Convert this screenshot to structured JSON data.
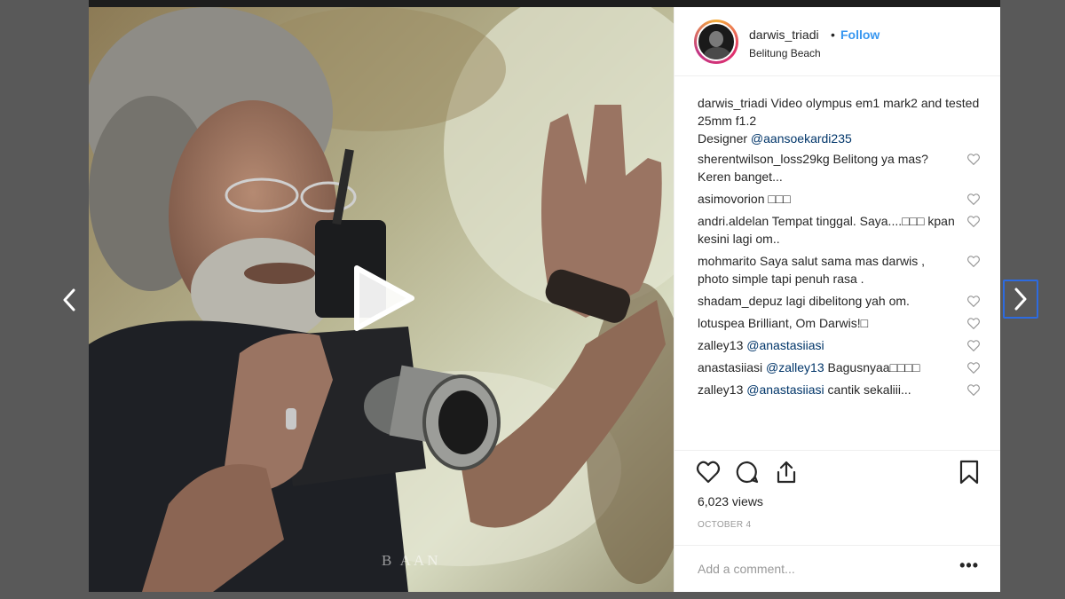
{
  "header": {
    "username": "darwis_triadi",
    "separator": "•",
    "follow_label": "Follow",
    "location": "Belitung Beach"
  },
  "caption": {
    "username": "darwis_triadi",
    "text_line1": " Video olympus em1 mark2 and tested 25mm f1.2",
    "text_prefix": "Designer ",
    "mention": "@aansoekardi235"
  },
  "comments": [
    {
      "user": "sherentwilson_loss29kg",
      "text": " Belitong ya mas? Keren banget..."
    },
    {
      "user": "asimovorion",
      "text": " □□□"
    },
    {
      "user": "andri.aldelan",
      "text": " Tempat tinggal. Saya....□□□ kpan kesini lagi om.."
    },
    {
      "user": "mohmarito",
      "text": " Saya salut sama mas darwis , photo simple tapi penuh rasa ."
    },
    {
      "user": "shadam_depuz",
      "text": " lagi dibelitong yah om."
    },
    {
      "user": "lotuspea",
      "text": " Brilliant, Om Darwis!□"
    },
    {
      "user": "zalley13",
      "text": "",
      "mention": "@anastasiiasi",
      "after": ""
    },
    {
      "user": "anastasiiasi",
      "text": "",
      "mention": "@zalley13",
      "after": " Bagusnyaa□□□□"
    },
    {
      "user": "zalley13",
      "text": "",
      "mention": "@anastasiiasi",
      "after": " cantik sekaliii..."
    }
  ],
  "stats": {
    "views": "6,023 views",
    "date": "OCTOBER 4"
  },
  "add_comment": {
    "placeholder": "Add a comment..."
  },
  "more_label": "•••",
  "media": {
    "watermark": "B              AAN"
  },
  "icons": {
    "prev": "chevron-left-icon",
    "next": "chevron-right-icon",
    "play": "play-icon",
    "like": "heart-icon",
    "comment": "comment-icon",
    "share": "share-icon",
    "save": "bookmark-icon"
  },
  "colors": {
    "link": "#3897f0",
    "mention": "#003569",
    "text": "#262626",
    "muted": "#999999",
    "focus_outline": "#2d6be0"
  }
}
